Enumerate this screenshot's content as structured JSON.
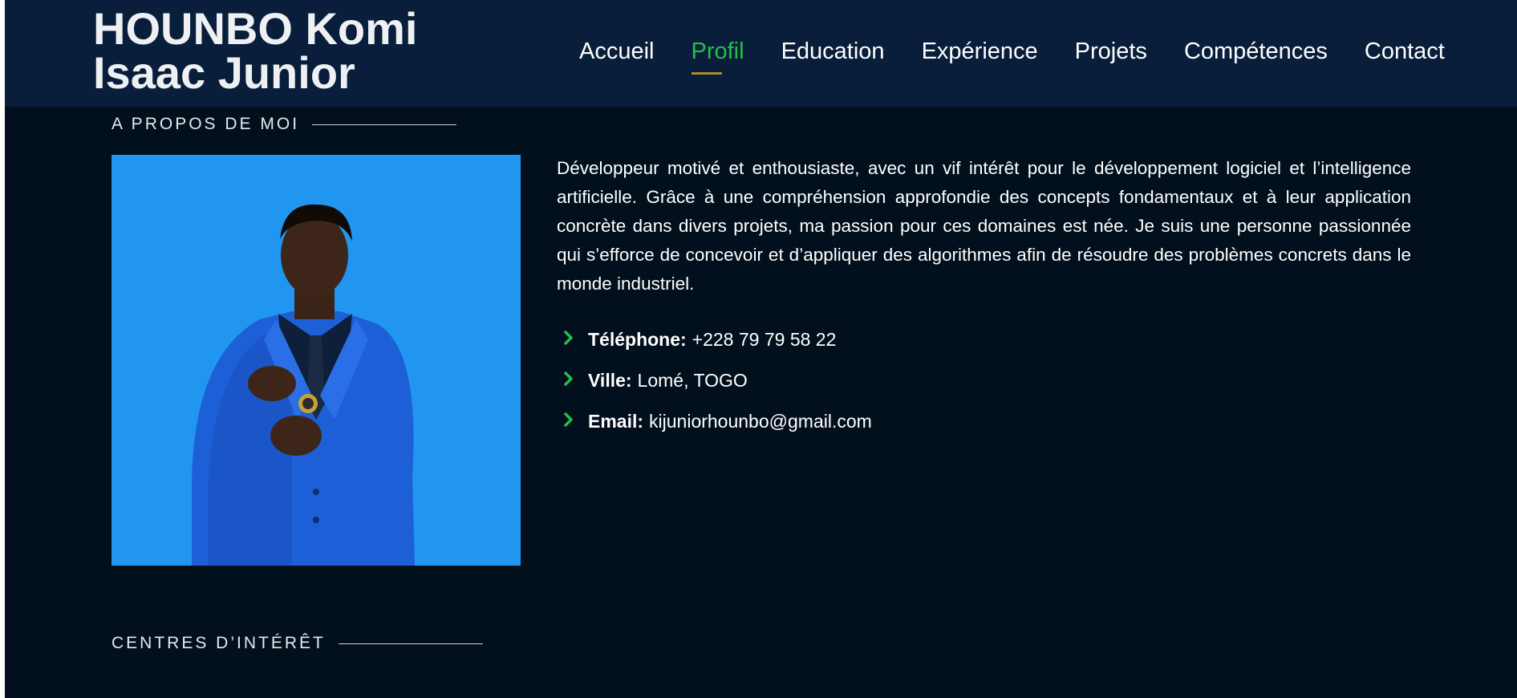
{
  "header": {
    "site_title": "HOUNBO Komi Isaac Junior",
    "nav": [
      {
        "label": "Accueil",
        "active": false
      },
      {
        "label": "Profil",
        "active": true
      },
      {
        "label": "Education",
        "active": false
      },
      {
        "label": "Expérience",
        "active": false
      },
      {
        "label": "Projets",
        "active": false
      },
      {
        "label": "Compétences",
        "active": false
      },
      {
        "label": "Contact",
        "active": false
      }
    ]
  },
  "about": {
    "heading": "A PROPOS DE MOI",
    "bio": "Développeur motivé et enthousiaste, avec un vif intérêt pour le développement logiciel et l’intelligence artificielle. Grâce à une compréhension approfondie des concepts fondamentaux et à leur application concrète dans divers projets, ma passion pour ces domaines est née. Je suis une personne passionnée qui s’efforce de concevoir et d’appliquer des algorithmes afin de résoudre des problèmes concrets dans le monde industriel.",
    "info": [
      {
        "label": "Téléphone:",
        "value": "+228 79 79 58 22"
      },
      {
        "label": "Ville:",
        "value": "Lomé, TOGO"
      },
      {
        "label": "Email:",
        "value": "kijuniorhounbo@gmail.com"
      }
    ]
  },
  "interests": {
    "heading": "CENTRES D’INTÉRÊT"
  },
  "colors": {
    "header_bg": "#081e3a",
    "page_bg": "#020f1c",
    "accent_green": "#22c04a",
    "underline_gold": "#b08a2a",
    "photo_bg": "#2196f0"
  },
  "icons": {
    "list_bullet": "chevron-right-icon"
  }
}
